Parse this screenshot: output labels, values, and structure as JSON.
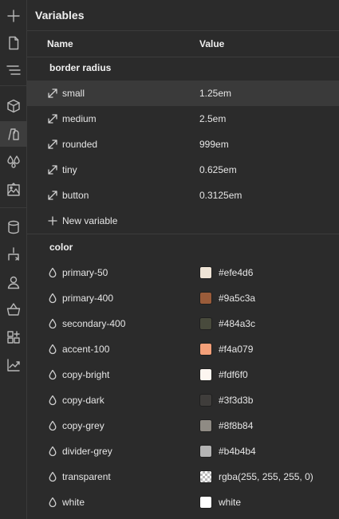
{
  "panel": {
    "title": "Variables"
  },
  "columns": {
    "name": "Name",
    "value": "Value"
  },
  "groups": {
    "border_radius": {
      "title": "border radius",
      "items": [
        {
          "name": "small",
          "value": "1.25em"
        },
        {
          "name": "medium",
          "value": "2.5em"
        },
        {
          "name": "rounded",
          "value": "999em"
        },
        {
          "name": "tiny",
          "value": "0.625em"
        },
        {
          "name": "button",
          "value": "0.3125em"
        }
      ],
      "add_label": "New variable"
    },
    "color": {
      "title": "color",
      "items": [
        {
          "name": "primary-50",
          "value": "#efe4d6",
          "swatch": "#efe4d6"
        },
        {
          "name": "primary-400",
          "value": "#9a5c3a",
          "swatch": "#9a5c3a"
        },
        {
          "name": "secondary-400",
          "value": "#484a3c",
          "swatch": "#484a3c"
        },
        {
          "name": "accent-100",
          "value": "#f4a079",
          "swatch": "#f4a079"
        },
        {
          "name": "copy-bright",
          "value": "#fdf6f0",
          "swatch": "#fdf6f0"
        },
        {
          "name": "copy-dark",
          "value": "#3f3d3b",
          "swatch": "#3f3d3b"
        },
        {
          "name": "copy-grey",
          "value": "#8f8b84",
          "swatch": "#8f8b84"
        },
        {
          "name": "divider-grey",
          "value": "#b4b4b4",
          "swatch": "#b4b4b4"
        },
        {
          "name": "transparent",
          "value": "rgba(255, 255, 255, 0)",
          "swatch": "transparent"
        },
        {
          "name": "white",
          "value": "white",
          "swatch": "#ffffff"
        }
      ]
    }
  },
  "rail_icons": [
    "add-icon",
    "page-icon",
    "navigator-icon",
    "components-icon",
    "variables-icon",
    "styles-icon",
    "assets-icon",
    "database-icon",
    "logic-icon",
    "users-icon",
    "ecommerce-icon",
    "apps-icon",
    "insights-icon"
  ]
}
